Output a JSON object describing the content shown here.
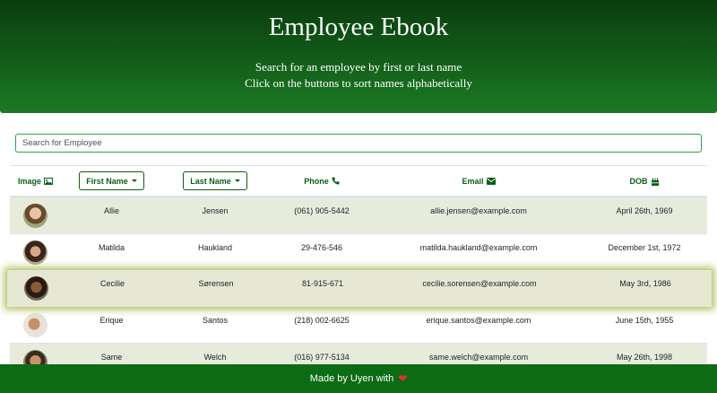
{
  "header": {
    "title": "Employee Ebook",
    "subtitle_1": "Search for an employee by first or last name",
    "subtitle_2": "Click on the buttons to sort names alphabetically",
    "gradient_top": "#0a3d10",
    "gradient_bottom": "#1a7a22"
  },
  "search": {
    "placeholder": "Search for Employee",
    "value": ""
  },
  "table": {
    "columns": {
      "image": "Image",
      "first_name": "First Name",
      "last_name": "Last Name",
      "phone": "Phone",
      "email": "Email",
      "dob": "DOB"
    },
    "column_icons": {
      "image": "image-icon",
      "phone": "phone-icon",
      "email": "envelope-icon",
      "dob": "birthday-cake-icon"
    },
    "rows": [
      {
        "first": "Allie",
        "last": "Jensen",
        "phone": "(061) 905-5442",
        "email": "allie.jensen@example.com",
        "dob": "April 26th, 1969"
      },
      {
        "first": "Matilda",
        "last": "Haukland",
        "phone": "29-476-546",
        "email": "matilda.haukland@example.com",
        "dob": "December 1st, 1972"
      },
      {
        "first": "Cecilie",
        "last": "Sørensen",
        "phone": "81-915-671",
        "email": "cecilie.sorensen@example.com",
        "dob": "May 3rd, 1986"
      },
      {
        "first": "Erique",
        "last": "Santos",
        "phone": "(218) 002-6625",
        "email": "erique.santos@example.com",
        "dob": "June 15th, 1955"
      },
      {
        "first": "Same",
        "last": "Welch",
        "phone": "(016) 977-5134",
        "email": "same.welch@example.com",
        "dob": "May 26th, 1998"
      }
    ]
  },
  "footer": {
    "text": "Made by Uyen with",
    "icon": "heart-icon",
    "background": "#0d6b14"
  },
  "colors": {
    "accent": "#0d5c16",
    "search_border": "#28a745",
    "row_stripe": "#e7ebdc",
    "highlight_glow": "#96aa28"
  }
}
